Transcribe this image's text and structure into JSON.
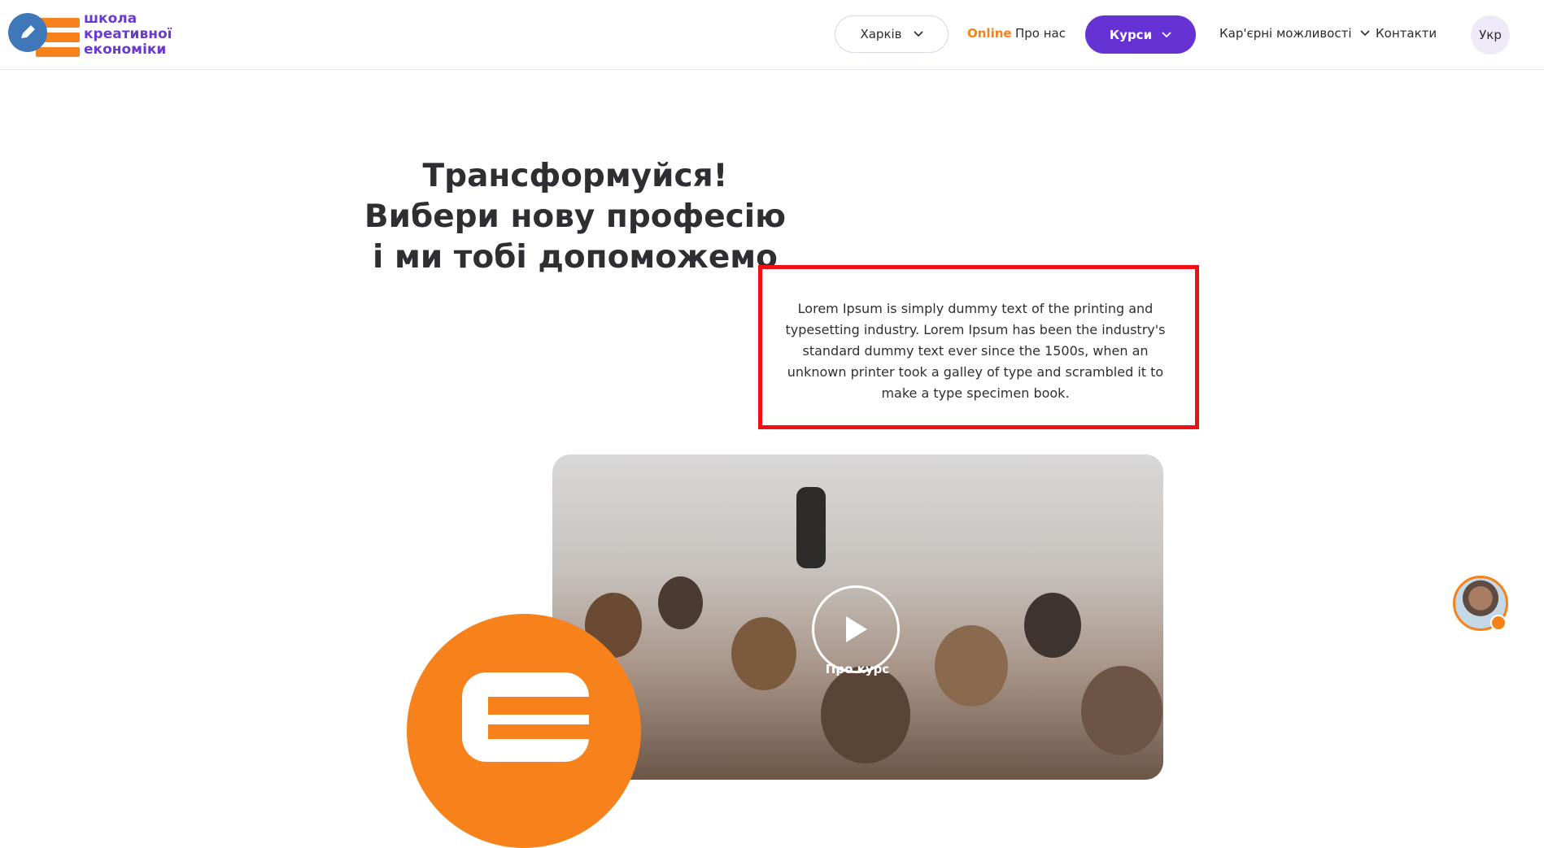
{
  "brand": {
    "line1": "школа",
    "line2": "креативної",
    "line3": "економіки",
    "colors": {
      "orange": "#f7821b",
      "purple": "#6632d4",
      "blue": "#3e78b8"
    }
  },
  "nav": {
    "city": "Харків",
    "online": "Online",
    "about": "Про нас",
    "courses": "Курси",
    "career": "Кар'єрні можливості",
    "contacts": "Контакти",
    "lang": "Укр"
  },
  "hero": {
    "title": "Трансформуйся! Вибери нову професію і ми тобі допоможемо",
    "lorem": "Lorem Ipsum is simply dummy text of the printing and typesetting industry. Lorem Ipsum has been the industry's standard dummy text ever since the 1500s, when an unknown printer took a galley of type and scrambled it to make a type specimen book."
  },
  "video": {
    "play_label": "Про курс",
    "icons": [
      "play-icon"
    ]
  },
  "widgets": {
    "chat_icon": "chat-avatar-icon"
  }
}
